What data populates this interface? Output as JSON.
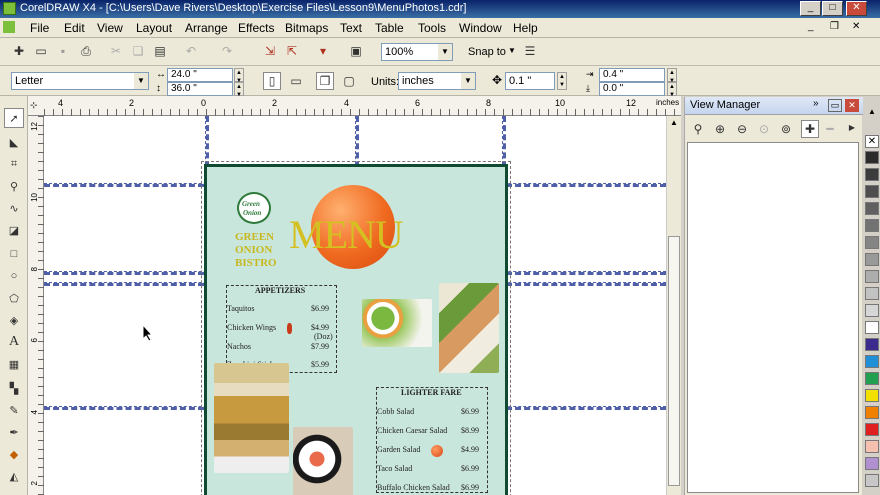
{
  "window": {
    "title": "CorelDRAW X4 - [C:\\Users\\Dave Rivers\\Desktop\\Exercise Files\\Lesson9\\MenuPhotos1.cdr]",
    "min": "_",
    "max": "□",
    "close": "✕"
  },
  "menubar": [
    "File",
    "Edit",
    "View",
    "Layout",
    "Arrange",
    "Effects",
    "Bitmaps",
    "Text",
    "Table",
    "Tools",
    "Window",
    "Help"
  ],
  "toolbar": {
    "zoom": "100%",
    "snap_to": "Snap to"
  },
  "propbar": {
    "paper": "Letter",
    "width": "24.0 \"",
    "height": "36.0 \"",
    "units_label": "Units:",
    "units": "inches",
    "nudge": "0.1 \"",
    "dup_x": "0.4 \"",
    "dup_y": "0.0 \""
  },
  "ruler": {
    "h_ticks": [
      "4",
      "2",
      "0",
      "2",
      "4",
      "6",
      "8",
      "10",
      "12"
    ],
    "h_unit": "inches",
    "v_ticks": [
      "12",
      "10",
      "8",
      "6",
      "4",
      "2"
    ]
  },
  "docker": {
    "title": "View Manager"
  },
  "menu_doc": {
    "logo_line1": "Green",
    "logo_line2": "Onion",
    "brand": [
      "GREEN",
      "ONION",
      "BISTRO"
    ],
    "title": "MENU",
    "appetizers_header": "APPETIZERS",
    "appetizers": [
      {
        "name": "Taquitos",
        "price": "$6.99"
      },
      {
        "name": "Chicken Wings",
        "price": "$4.99",
        "note": "(Doz)"
      },
      {
        "name": "Nachos",
        "price": "$7.99"
      },
      {
        "name": "Zucchini Sticks",
        "price": "$5.99"
      }
    ],
    "lighter_header": "LIGHTER FARE",
    "lighter": [
      {
        "name": "Cobb Salad",
        "price": "$6.99"
      },
      {
        "name": "Chicken Caesar Salad",
        "price": "$8.99"
      },
      {
        "name": "Garden Salad",
        "price": "$4.99"
      },
      {
        "name": "Taco Salad",
        "price": "$6.99"
      },
      {
        "name": "Buffalo Chicken Salad",
        "price": "$6.99"
      }
    ]
  },
  "palette": [
    "#2b2b2b",
    "#3c3c3c",
    "#4e4e4e",
    "#606060",
    "#727272",
    "#858585",
    "#999999",
    "#adadad",
    "#c2c2c2",
    "#d6d6d6",
    "#ffffff",
    "#3b2b8f",
    "#1f8fd8",
    "#20a050",
    "#f4e000",
    "#f08000",
    "#e02020",
    "#f5c0b0",
    "#b090d0",
    "#c7c7c7"
  ]
}
